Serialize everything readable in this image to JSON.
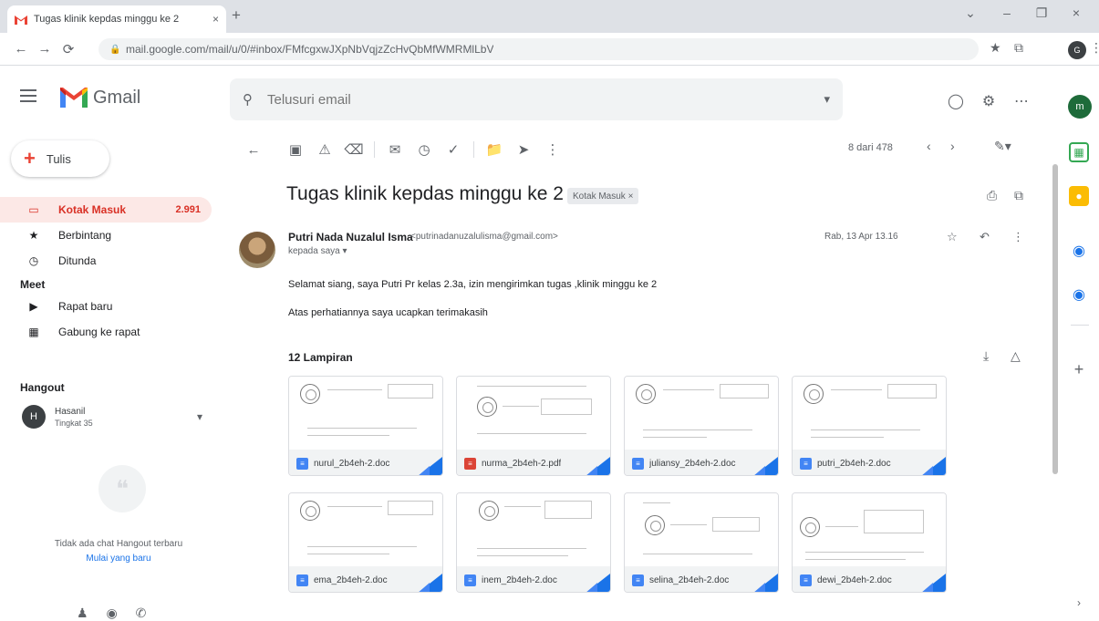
{
  "browser": {
    "tab_title": "Tugas klinik kepdas minggu ke 2",
    "tab_close": "×",
    "new_tab": "+",
    "url": "mail.google.com/mail/u/0/#inbox/FMfcgxwJXpNbVqjzZcHvQbMfWMRMlLbV",
    "window_controls": [
      "⌄",
      "–",
      "❐",
      "×"
    ],
    "nav": {
      "back": "←",
      "forward": "→",
      "reload": "⟳"
    },
    "toolbar_icons": [
      "★",
      "⧉",
      "⋮"
    ],
    "profile_initial": "G"
  },
  "header": {
    "app_name": "Gmail",
    "search_placeholder": "Telusuri email",
    "search_tune": "▾",
    "icons": [
      "support-icon",
      "settings-icon",
      "apps-icon"
    ],
    "avatar_initial": "m"
  },
  "sidebar": {
    "compose_label": "Tulis",
    "items": [
      {
        "label": "Kotak Masuk",
        "count": "2.991",
        "icon": "▭",
        "active": true
      },
      {
        "label": "Berbintang",
        "count": "",
        "icon": "★",
        "active": false
      },
      {
        "label": "Ditunda",
        "count": "",
        "icon": "◷",
        "active": false
      }
    ],
    "meet_header": "Meet",
    "meet_items": [
      {
        "label": "Rapat baru",
        "icon": "▶"
      },
      {
        "label": "Gabung ke rapat",
        "icon": "▦"
      }
    ],
    "hangouts_header": "Hangout",
    "hangouts_user": "Hasanil",
    "hangouts_status": "Tingkat 35",
    "hangouts_initial": "H",
    "hangouts_more": "▾",
    "hangouts_empty": "Tidak ada chat Hangout terbaru",
    "hangouts_link": "Mulai yang baru",
    "bottom_icons": [
      "person-icon",
      "location-icon",
      "phone-icon"
    ]
  },
  "toolbar": {
    "back": "←",
    "actions": [
      "archive-icon",
      "spam-icon",
      "delete-icon",
      "mark-unread-icon",
      "snooze-icon",
      "add-task-icon",
      "move-icon",
      "label-icon",
      "more-icon"
    ],
    "pager_text": "8 dari 478",
    "prev": "‹",
    "next": "›",
    "tools": "✎▾"
  },
  "message": {
    "subject": "Tugas klinik kepdas minggu ke 2",
    "label": "Kotak Masuk ×",
    "sender_name": "Putri Nada Nuzalul Isma",
    "sender_email": "<putrinadanuzalulisma@gmail.com>",
    "to_me": "kepada saya ▾",
    "date": "Rab, 13 Apr 13.16",
    "body_line1": "Selamat siang, saya Putri Pr kelas 2.3a, izin mengirimkan tugas ,klinik minggu ke 2",
    "body_line2": "Atas perhatiannya saya ucapkan terimakasih",
    "attachments_title": "12 Lampiran",
    "attachments": [
      {
        "name": "nurul_2b4eh-2.doc",
        "type": "doc"
      },
      {
        "name": "nurma_2b4eh-2.pdf",
        "type": "pdf"
      },
      {
        "name": "juliansy_2b4eh-2.doc",
        "type": "doc"
      },
      {
        "name": "putri_2b4eh-2.doc",
        "type": "doc"
      },
      {
        "name": "ema_2b4eh-2.doc",
        "type": "doc"
      },
      {
        "name": "inem_2b4eh-2.doc",
        "type": "doc"
      },
      {
        "name": "selina_2b4eh-2.doc",
        "type": "doc"
      },
      {
        "name": "dewi_2b4eh-2.doc",
        "type": "doc"
      }
    ]
  },
  "side_panel": {
    "icons": [
      "calendar-icon",
      "keep-icon",
      "tasks-icon",
      "contacts-icon",
      "add-icon"
    ]
  },
  "colors": {
    "accent_red": "#ea4335",
    "active_bg": "#fce8e6",
    "doc_blue": "#4285f4",
    "pdf_red": "#db4437"
  }
}
